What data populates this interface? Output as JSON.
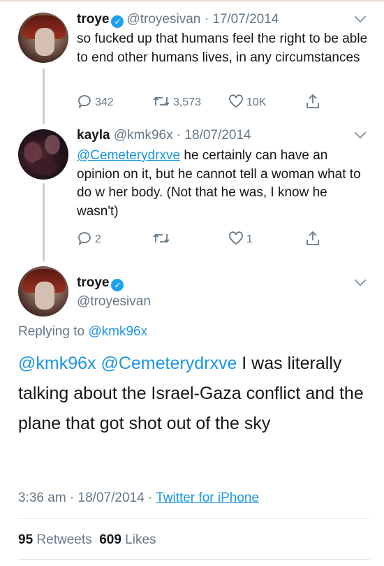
{
  "tweet1": {
    "name": "troye",
    "handle": "@troyesivan",
    "date": "17/07/2014",
    "text": "so fucked up that humans feel the right to be able to end other humans lives, in any circumstances",
    "replies": "342",
    "retweets": "3,573",
    "likes": "10K"
  },
  "tweet2": {
    "name": "kayla",
    "handle": "@kmk96x",
    "date": "18/07/2014",
    "mention": "@Cemeterydrxve",
    "text": " he certainly can have an opinion on it, but he cannot tell a woman what to do w her body. (Not that he was, I know he wasn't)",
    "replies": "2",
    "likes": "1"
  },
  "main": {
    "name": "troye",
    "handle": "@troyesivan",
    "replying_prefix": "Replying to ",
    "replying_to": "@kmk96x",
    "mention1": "@kmk96x",
    "mention2": "@Cemeterydrxve",
    "text": " I was literally talking about the Israel-Gaza conflict and the plane that got shot out of the sky",
    "time": "3:36 am",
    "date": "18/07/2014",
    "source": "Twitter for iPhone",
    "retweet_count": "95",
    "retweet_label": "Retweets",
    "like_count": "609",
    "like_label": "Likes"
  },
  "icons": [
    "reply-icon",
    "retweet-icon",
    "like-icon",
    "share-icon",
    "verified-icon",
    "chevron-down-icon"
  ],
  "colors": {
    "link": "#1b95e0",
    "muted": "#657786",
    "verified": "#1da1f2"
  }
}
